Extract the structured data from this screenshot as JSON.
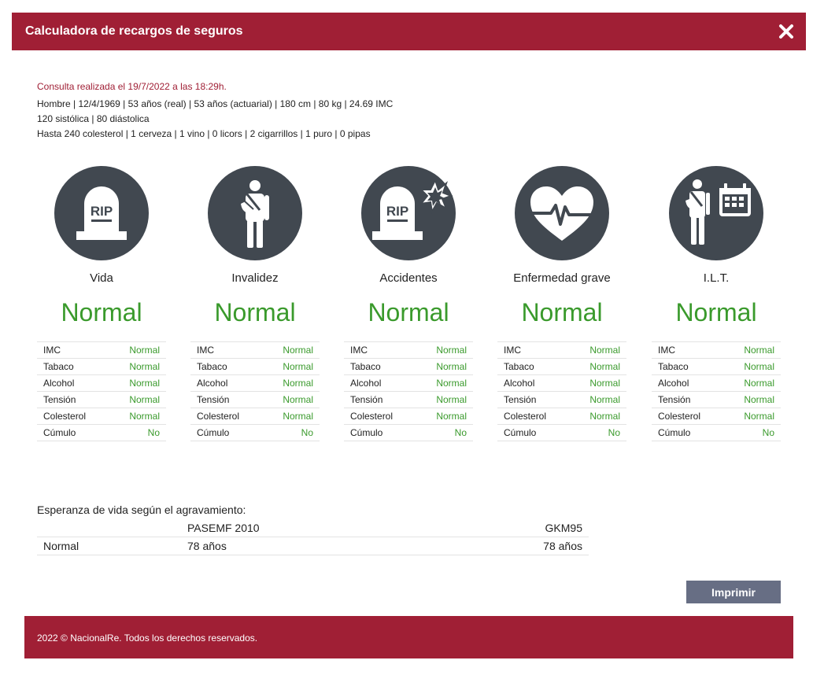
{
  "header": {
    "title": "Calculadora de recargos de seguros"
  },
  "info": {
    "consulta": "Consulta realizada el 19/7/2022 a las 18:29h.",
    "line1": "Hombre | 12/4/1969 | 53 años (real) | 53 años (actuarial) | 180 cm | 80 kg | 24.69 IMC",
    "line2": "120 sistólica | 80 diástolica",
    "line3": "Hasta 240 colesterol | 1 cerveza | 1 vino | 0 licors | 2 cigarrillos | 1 puro | 0 pipas"
  },
  "columns": [
    {
      "icon": "tombstone-rip-icon",
      "name": "Vida",
      "status": "Normal",
      "rows": [
        {
          "k": "IMC",
          "v": "Normal"
        },
        {
          "k": "Tabaco",
          "v": "Normal"
        },
        {
          "k": "Alcohol",
          "v": "Normal"
        },
        {
          "k": "Tensión",
          "v": "Normal"
        },
        {
          "k": "Colesterol",
          "v": "Normal"
        },
        {
          "k": "Cúmulo",
          "v": "No"
        }
      ]
    },
    {
      "icon": "injured-person-icon",
      "name": "Invalidez",
      "status": "Normal",
      "rows": [
        {
          "k": "IMC",
          "v": "Normal"
        },
        {
          "k": "Tabaco",
          "v": "Normal"
        },
        {
          "k": "Alcohol",
          "v": "Normal"
        },
        {
          "k": "Tensión",
          "v": "Normal"
        },
        {
          "k": "Colesterol",
          "v": "Normal"
        },
        {
          "k": "Cúmulo",
          "v": "No"
        }
      ]
    },
    {
      "icon": "tombstone-crash-icon",
      "name": "Accidentes",
      "status": "Normal",
      "rows": [
        {
          "k": "IMC",
          "v": "Normal"
        },
        {
          "k": "Tabaco",
          "v": "Normal"
        },
        {
          "k": "Alcohol",
          "v": "Normal"
        },
        {
          "k": "Tensión",
          "v": "Normal"
        },
        {
          "k": "Colesterol",
          "v": "Normal"
        },
        {
          "k": "Cúmulo",
          "v": "No"
        }
      ]
    },
    {
      "icon": "heart-pulse-icon",
      "name": "Enfermedad grave",
      "status": "Normal",
      "rows": [
        {
          "k": "IMC",
          "v": "Normal"
        },
        {
          "k": "Tabaco",
          "v": "Normal"
        },
        {
          "k": "Alcohol",
          "v": "Normal"
        },
        {
          "k": "Tensión",
          "v": "Normal"
        },
        {
          "k": "Colesterol",
          "v": "Normal"
        },
        {
          "k": "Cúmulo",
          "v": "No"
        }
      ]
    },
    {
      "icon": "injured-person-calendar-icon",
      "name": "I.L.T.",
      "status": "Normal",
      "rows": [
        {
          "k": "IMC",
          "v": "Normal"
        },
        {
          "k": "Tabaco",
          "v": "Normal"
        },
        {
          "k": "Alcohol",
          "v": "Normal"
        },
        {
          "k": "Tensión",
          "v": "Normal"
        },
        {
          "k": "Colesterol",
          "v": "Normal"
        },
        {
          "k": "Cúmulo",
          "v": "No"
        }
      ]
    }
  ],
  "esperanza": {
    "title": "Esperanza de vida según el agravamiento:",
    "col1": "PASEMF 2010",
    "col2": "GKM95",
    "row": {
      "label": "Normal",
      "v1": "78 años",
      "v2": "78 años"
    }
  },
  "print_button": "Imprimir",
  "footer": "2022 © NacionalRe. Todos los derechos reservados.",
  "colors": {
    "brand": "#a01f35",
    "ok": "#3a9a2c",
    "icon_bg": "#414850",
    "button": "#676e84"
  }
}
